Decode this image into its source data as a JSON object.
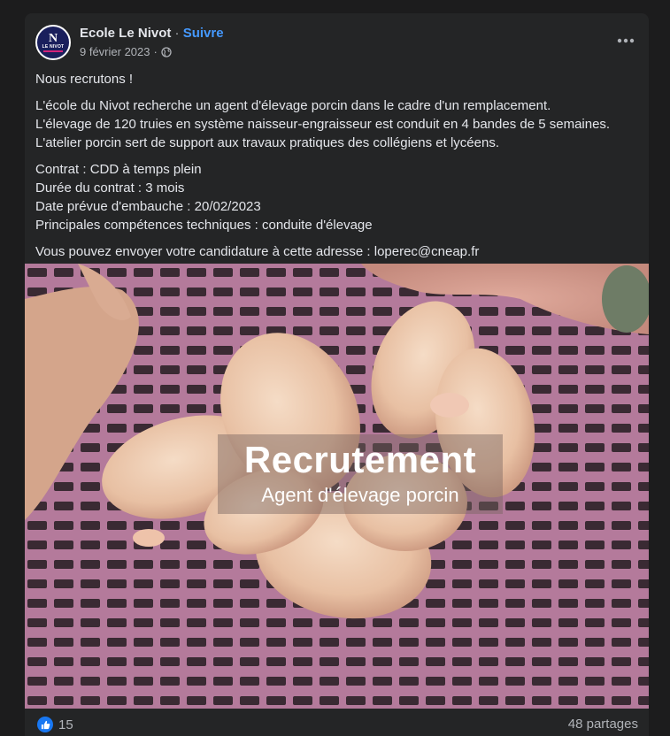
{
  "post": {
    "author": "Ecole Le Nivot",
    "separator": "·",
    "follow_label": "Suivre",
    "date": "9 février 2023",
    "date_separator": "·",
    "privacy_icon": "globe-icon",
    "more_icon": "more-horizontal-icon",
    "avatar": {
      "letter": "N",
      "text": "LE NIVOT"
    },
    "body": {
      "heading": "Nous recrutons !",
      "paragraph1": [
        "L'école du Nivot recherche un agent d'élevage porcin dans le cadre d'un remplacement.",
        "L'élevage de 120 truies en système naisseur-engraisseur est conduit en 4 bandes de 5 semaines.",
        "L'atelier porcin sert de support aux travaux pratiques des collégiens et lycéens."
      ],
      "paragraph2": [
        "Contrat : CDD à temps plein",
        "Durée du contrat : 3 mois",
        "Date prévue d'embauche : 20/02/2023",
        "Principales compétences techniques : conduite d'élevage"
      ],
      "paragraph3": "Vous pouvez envoyer votre candidature à cette adresse : loperec@cneap.fr"
    },
    "image": {
      "title": "Recrutement",
      "subtitle": "Agent d'élevage porcin"
    },
    "footer": {
      "like_icon": "thumbs-up-icon",
      "reaction_count": "15",
      "shares_label": "48 partages"
    }
  },
  "colors": {
    "background": "#1c1c1d",
    "card": "#242526",
    "text_primary": "#e4e6eb",
    "text_secondary": "#b0b3b8",
    "link": "#4599ff",
    "like": "#1877f2",
    "floor_grid": "#b2789a"
  }
}
